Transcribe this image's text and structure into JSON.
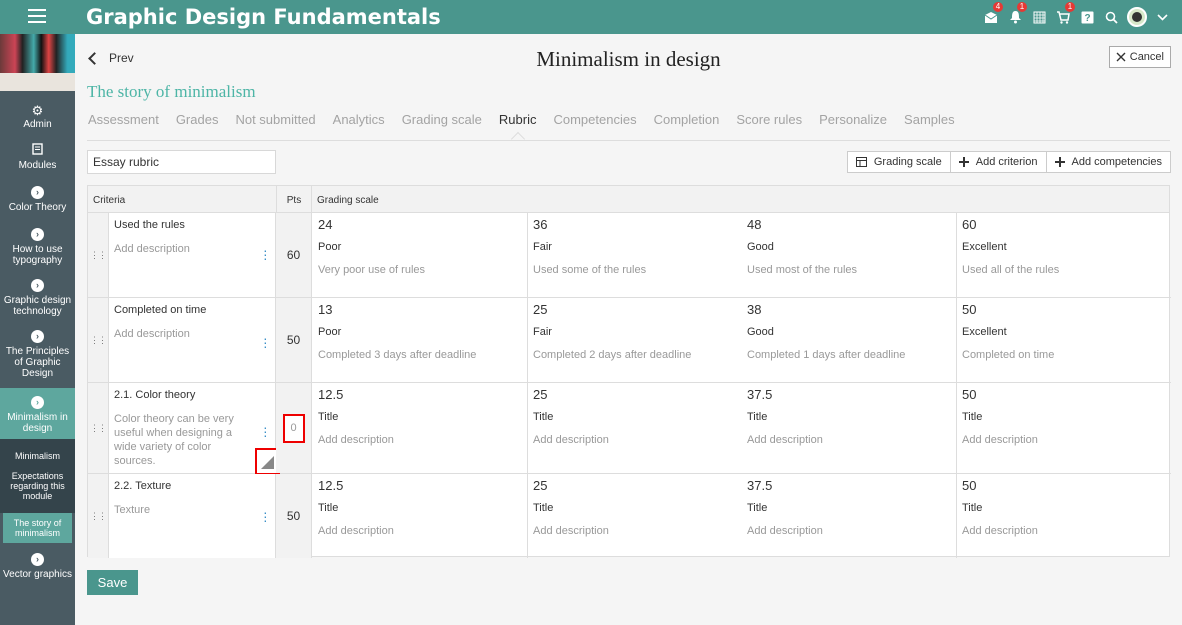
{
  "app": {
    "title": "Graphic Design Fundamentals",
    "badges": {
      "messages": "4",
      "notifications": "1",
      "cart": "1"
    },
    "accent": "#4a968d"
  },
  "sidebar": {
    "items": [
      {
        "label": "Admin",
        "icon": "gear-icon"
      },
      {
        "label": "Modules",
        "icon": "book-icon"
      },
      {
        "label": "Color Theory",
        "icon": "chevron-right-icon"
      },
      {
        "label": "How to use typography",
        "icon": "chevron-right-icon"
      },
      {
        "label": "Graphic design technology",
        "icon": "chevron-right-icon"
      },
      {
        "label": "The Principles of Graphic Design",
        "icon": "chevron-right-icon"
      },
      {
        "label": "Minimalism in design",
        "icon": "chevron-right-icon"
      },
      {
        "label": "Vector graphics",
        "icon": "chevron-right-icon"
      }
    ],
    "subitems": [
      {
        "label": "Minimalism"
      },
      {
        "label": "Expectations regarding this module"
      },
      {
        "label": "The story of minimalism"
      }
    ]
  },
  "page": {
    "prev_label": "Prev",
    "title": "Minimalism in design",
    "cancel_label": "Cancel",
    "subtitle": "The story of minimalism"
  },
  "tabs": [
    "Assessment",
    "Grades",
    "Not submitted",
    "Analytics",
    "Grading scale",
    "Rubric",
    "Competencies",
    "Completion",
    "Score rules",
    "Personalize",
    "Samples"
  ],
  "rubric": {
    "name": "Essay rubric",
    "buttons": {
      "grading_scale": "Grading scale",
      "add_criterion": "Add criterion",
      "add_competencies": "Add competencies"
    },
    "headers": {
      "criteria": "Criteria",
      "pts": "Pts",
      "grading_scale": "Grading scale"
    },
    "rows": [
      {
        "name": "Used the rules",
        "desc": "Add description",
        "pts": "60",
        "levels": [
          {
            "value": "24",
            "title": "Poor",
            "desc": "Very poor use of rules"
          },
          {
            "value": "36",
            "title": "Fair",
            "desc": "Used some of the rules"
          },
          {
            "value": "48",
            "title": "Good",
            "desc": "Used most of the rules"
          },
          {
            "value": "60",
            "title": "Excellent",
            "desc": "Used all of the rules"
          }
        ]
      },
      {
        "name": "Completed on time",
        "desc": "Add description",
        "pts": "50",
        "levels": [
          {
            "value": "13",
            "title": "Poor",
            "desc": "Completed 3 days after deadline"
          },
          {
            "value": "25",
            "title": "Fair",
            "desc": "Completed 2 days after deadline"
          },
          {
            "value": "38",
            "title": "Good",
            "desc": "Completed 1 days after deadline"
          },
          {
            "value": "50",
            "title": "Excellent",
            "desc": "Completed on time"
          }
        ]
      },
      {
        "name": "2.1. Color theory",
        "desc": "Color theory can be very useful when designing a wide variety of color sources.",
        "pts": "0",
        "levels": [
          {
            "value": "12.5",
            "title": "Title",
            "desc": "Add description"
          },
          {
            "value": "25",
            "title": "Title",
            "desc": "Add description"
          },
          {
            "value": "37.5",
            "title": "Title",
            "desc": "Add description"
          },
          {
            "value": "50",
            "title": "Title",
            "desc": "Add description"
          }
        ]
      },
      {
        "name": "2.2. Texture",
        "desc": "Texture",
        "pts": "50",
        "levels": [
          {
            "value": "12.5",
            "title": "Title",
            "desc": "Add description"
          },
          {
            "value": "25",
            "title": "Title",
            "desc": "Add description"
          },
          {
            "value": "37.5",
            "title": "Title",
            "desc": "Add description"
          },
          {
            "value": "50",
            "title": "Title",
            "desc": "Add description"
          }
        ]
      }
    ]
  },
  "save_label": "Save"
}
